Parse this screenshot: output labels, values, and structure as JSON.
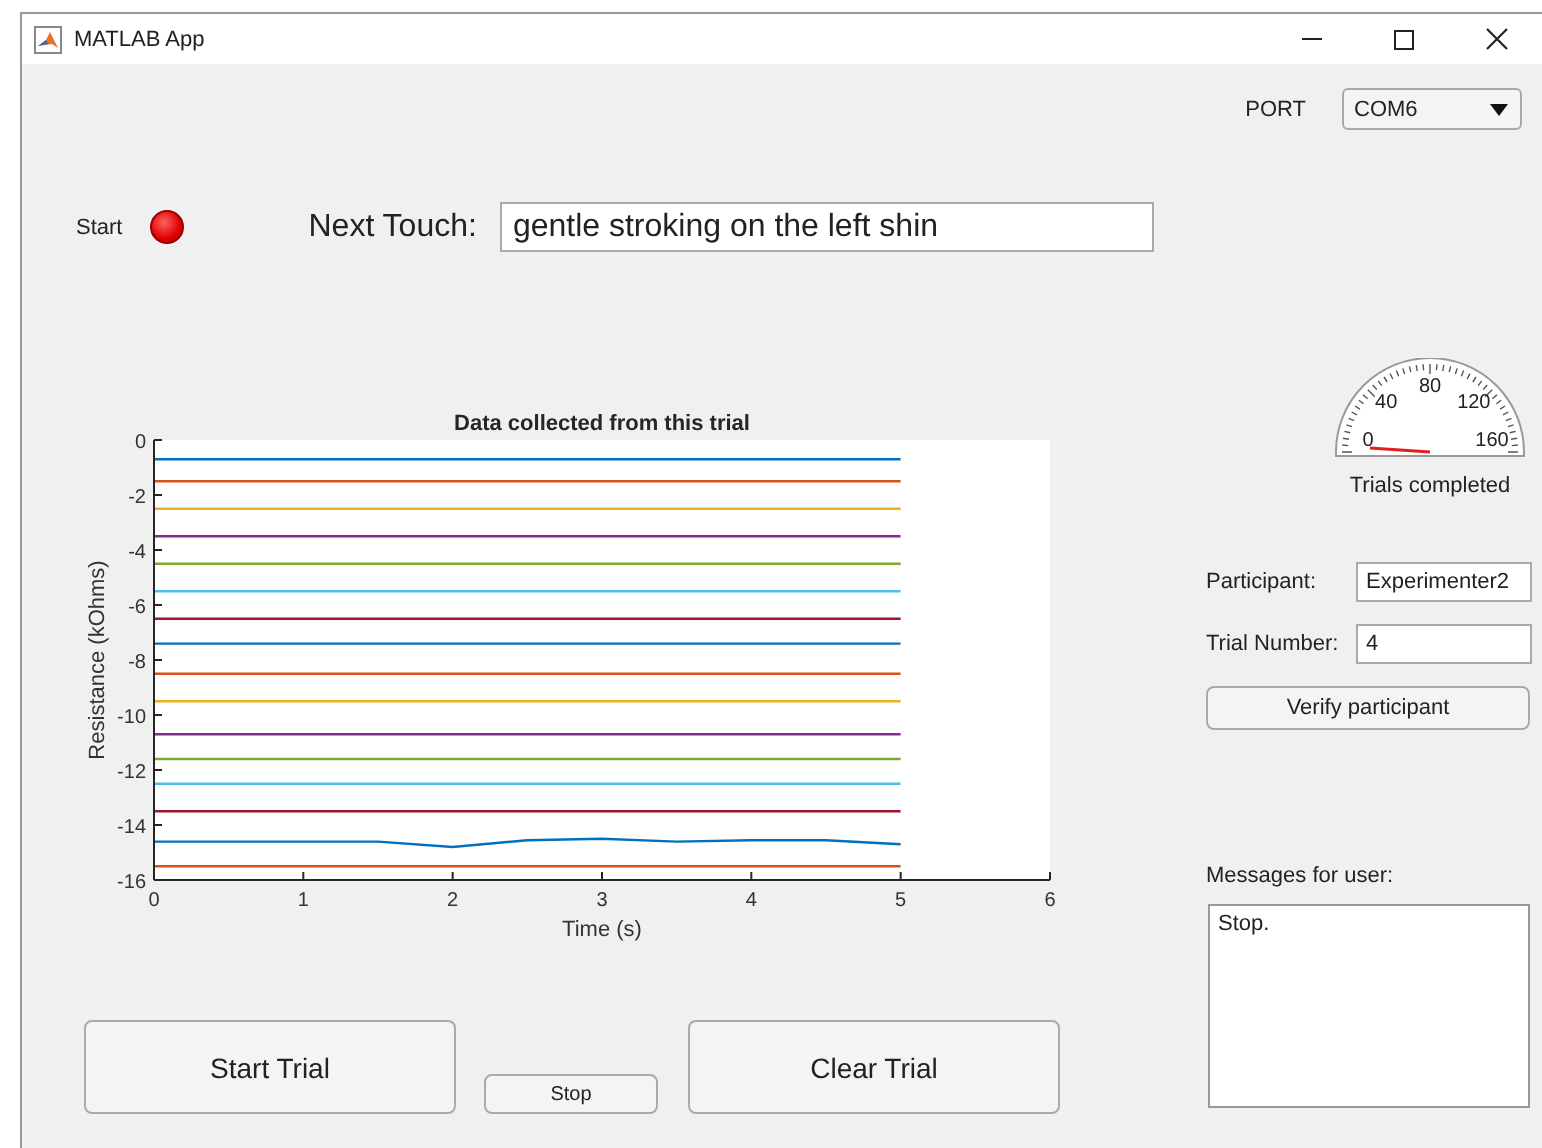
{
  "window": {
    "title": "MATLAB App"
  },
  "port": {
    "label": "PORT",
    "value": "COM6"
  },
  "start_lamp": {
    "label": "Start",
    "on": true
  },
  "next_touch": {
    "label": "Next Touch:",
    "value": "gentle stroking on the left shin"
  },
  "plot": {
    "chart_data": {
      "type": "line",
      "title": "Data collected from this trial",
      "xlabel": "Time (s)",
      "ylabel": "Resistance (kOhms)",
      "x": [
        0,
        0.5,
        1,
        1.5,
        2,
        2.5,
        3,
        3.5,
        4,
        4.5,
        5
      ],
      "xlim": [
        0,
        6
      ],
      "ylim": [
        -16,
        0
      ],
      "xticks": [
        0,
        1,
        2,
        3,
        4,
        5,
        6
      ],
      "yticks": [
        0,
        -2,
        -4,
        -6,
        -8,
        -10,
        -12,
        -14,
        -16
      ],
      "series": [
        {
          "color": "#0072bd",
          "values": [
            -0.7,
            -0.7,
            -0.7,
            -0.7,
            -0.7,
            -0.7,
            -0.7,
            -0.7,
            -0.7,
            -0.7,
            -0.7
          ]
        },
        {
          "color": "#d95319",
          "values": [
            -1.5,
            -1.5,
            -1.5,
            -1.5,
            -1.5,
            -1.5,
            -1.5,
            -1.5,
            -1.5,
            -1.5,
            -1.5
          ]
        },
        {
          "color": "#edb120",
          "values": [
            -2.5,
            -2.5,
            -2.5,
            -2.5,
            -2.5,
            -2.5,
            -2.5,
            -2.5,
            -2.5,
            -2.5,
            -2.5
          ]
        },
        {
          "color": "#7e2f8e",
          "values": [
            -3.5,
            -3.5,
            -3.5,
            -3.5,
            -3.5,
            -3.5,
            -3.5,
            -3.5,
            -3.5,
            -3.5,
            -3.5
          ]
        },
        {
          "color": "#77ac30",
          "values": [
            -4.5,
            -4.5,
            -4.5,
            -4.5,
            -4.5,
            -4.5,
            -4.5,
            -4.5,
            -4.5,
            -4.5,
            -4.5
          ]
        },
        {
          "color": "#4dbeee",
          "values": [
            -5.5,
            -5.5,
            -5.5,
            -5.5,
            -5.5,
            -5.5,
            -5.5,
            -5.5,
            -5.5,
            -5.5,
            -5.5
          ]
        },
        {
          "color": "#a2142f",
          "values": [
            -6.5,
            -6.5,
            -6.5,
            -6.5,
            -6.5,
            -6.5,
            -6.5,
            -6.5,
            -6.5,
            -6.5,
            -6.5
          ]
        },
        {
          "color": "#0072bd",
          "values": [
            -7.4,
            -7.4,
            -7.4,
            -7.4,
            -7.4,
            -7.4,
            -7.4,
            -7.4,
            -7.4,
            -7.4,
            -7.4
          ]
        },
        {
          "color": "#d95319",
          "values": [
            -8.5,
            -8.5,
            -8.5,
            -8.5,
            -8.5,
            -8.5,
            -8.5,
            -8.5,
            -8.5,
            -8.5,
            -8.5
          ]
        },
        {
          "color": "#edb120",
          "values": [
            -9.5,
            -9.5,
            -9.5,
            -9.5,
            -9.5,
            -9.5,
            -9.5,
            -9.5,
            -9.5,
            -9.5,
            -9.5
          ]
        },
        {
          "color": "#7e2f8e",
          "values": [
            -10.7,
            -10.7,
            -10.7,
            -10.7,
            -10.7,
            -10.7,
            -10.7,
            -10.7,
            -10.7,
            -10.7,
            -10.7
          ]
        },
        {
          "color": "#77ac30",
          "values": [
            -11.6,
            -11.6,
            -11.6,
            -11.6,
            -11.6,
            -11.6,
            -11.6,
            -11.6,
            -11.6,
            -11.6,
            -11.6
          ]
        },
        {
          "color": "#4dbeee",
          "values": [
            -12.5,
            -12.5,
            -12.5,
            -12.5,
            -12.5,
            -12.5,
            -12.5,
            -12.5,
            -12.5,
            -12.5,
            -12.5
          ]
        },
        {
          "color": "#a2142f",
          "values": [
            -13.5,
            -13.5,
            -13.5,
            -13.5,
            -13.5,
            -13.5,
            -13.5,
            -13.5,
            -13.5,
            -13.5,
            -13.5
          ]
        },
        {
          "color": "#0072bd",
          "values": [
            -14.6,
            -14.6,
            -14.6,
            -14.6,
            -14.8,
            -14.55,
            -14.5,
            -14.6,
            -14.55,
            -14.55,
            -14.7
          ]
        },
        {
          "color": "#d95319",
          "values": [
            -15.5,
            -15.5,
            -15.5,
            -15.5,
            -15.5,
            -15.5,
            -15.5,
            -15.5,
            -15.5,
            -15.5,
            -15.5
          ]
        }
      ]
    }
  },
  "gauge": {
    "labels": [
      "0",
      "40",
      "80",
      "120",
      "160"
    ],
    "caption": "Trials completed"
  },
  "participant": {
    "label": "Participant:",
    "value": "Experimenter2"
  },
  "trial_number": {
    "label": "Trial Number:",
    "value": "4"
  },
  "verify_button": {
    "label": "Verify participant"
  },
  "messages": {
    "label": "Messages for user:",
    "value": "Stop."
  },
  "buttons": [
    {
      "label": "Start Trial",
      "kind": "large"
    },
    {
      "label": "Stop",
      "kind": "small"
    },
    {
      "label": "Clear Trial",
      "kind": "large"
    }
  ]
}
